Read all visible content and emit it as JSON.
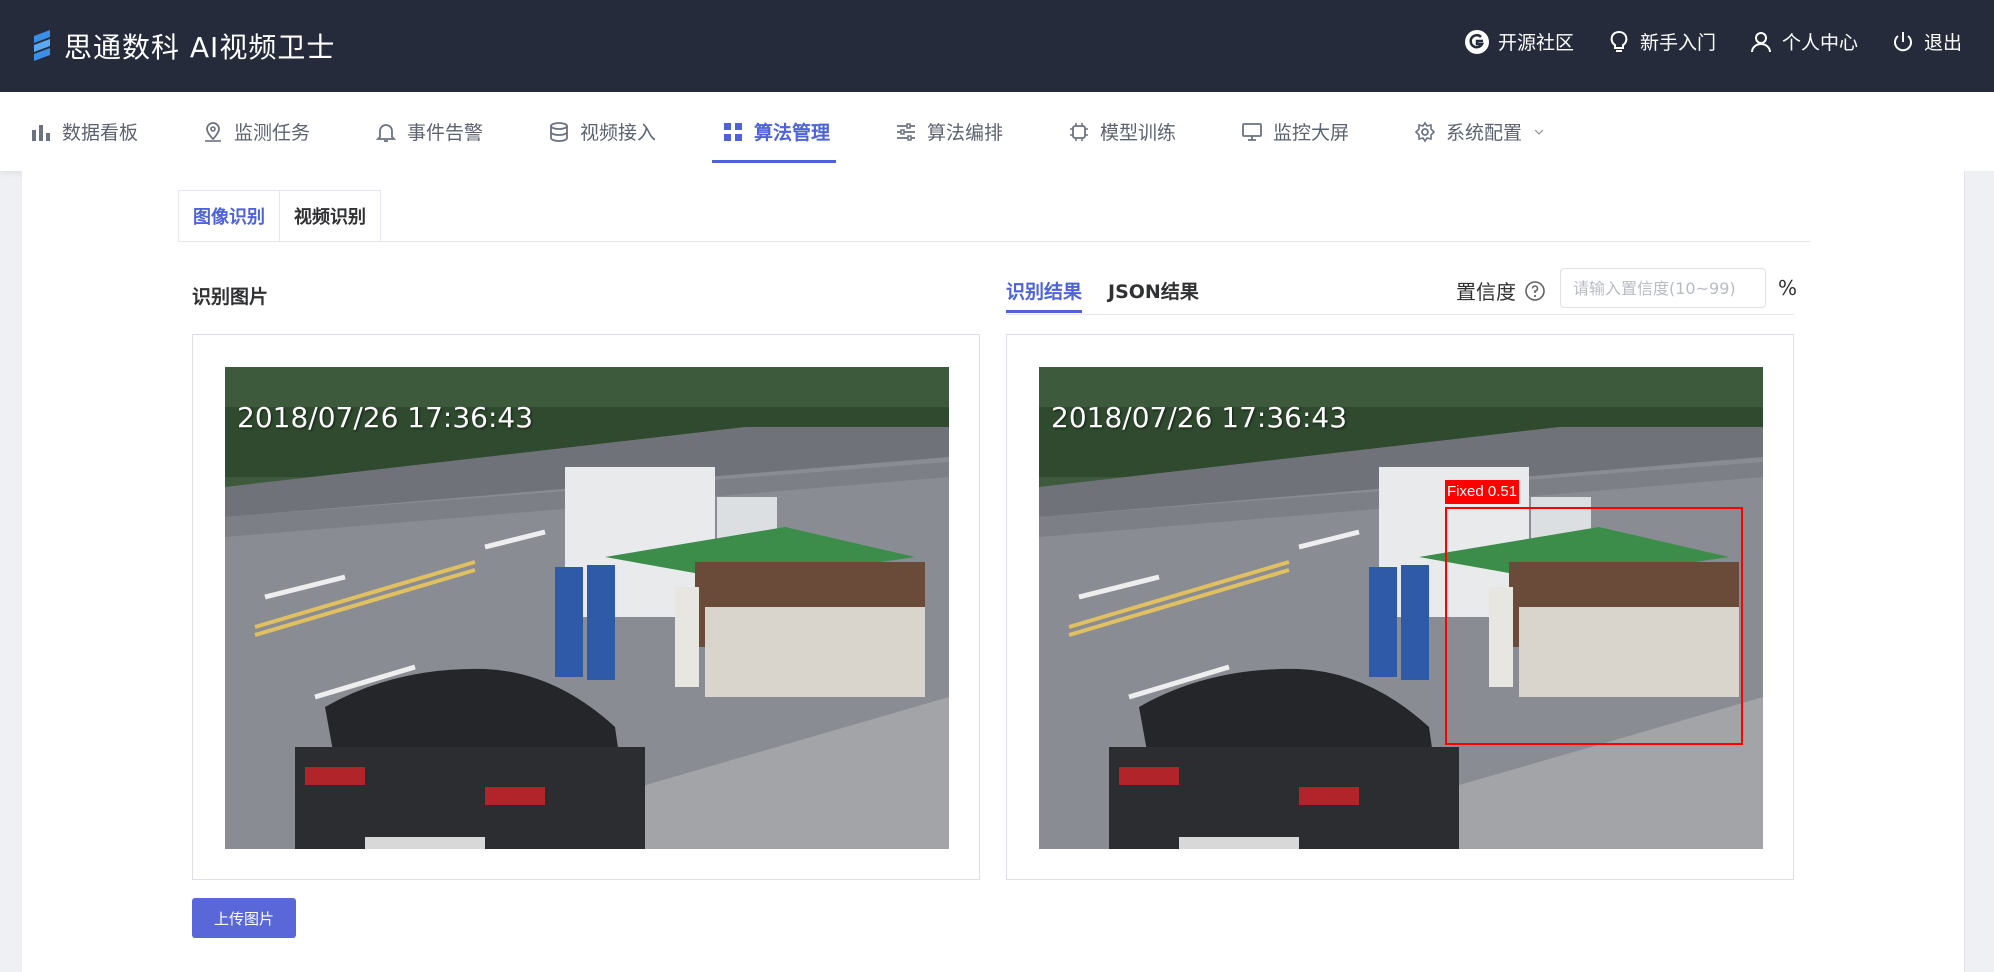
{
  "app": {
    "title": "思通数科 AI视频卫士"
  },
  "top_links": [
    {
      "label": "开源社区",
      "icon": "open-source-icon"
    },
    {
      "label": "新手入门",
      "icon": "lightbulb-icon"
    },
    {
      "label": "个人中心",
      "icon": "user-icon"
    },
    {
      "label": "退出",
      "icon": "power-icon"
    }
  ],
  "nav": [
    {
      "label": "数据看板",
      "icon": "bar-chart-icon"
    },
    {
      "label": "监测任务",
      "icon": "location-icon"
    },
    {
      "label": "事件告警",
      "icon": "bell-icon"
    },
    {
      "label": "视频接入",
      "icon": "database-icon"
    },
    {
      "label": "算法管理",
      "icon": "grid-icon",
      "active": true
    },
    {
      "label": "算法编排",
      "icon": "sliders-icon"
    },
    {
      "label": "模型训练",
      "icon": "chip-icon"
    },
    {
      "label": "监控大屏",
      "icon": "monitor-icon"
    },
    {
      "label": "系统配置",
      "icon": "gear-icon"
    }
  ],
  "subtabs": [
    "图像识别",
    "视频识别"
  ],
  "left_panel": {
    "title": "识别图片",
    "timestamp": "2018/07/26 17:36:43"
  },
  "result_tabs": [
    "识别结果",
    "JSON结果"
  ],
  "confidence": {
    "label": "置信度",
    "placeholder": "请输入置信度(10~99)",
    "unit": "%"
  },
  "detection": {
    "label": "Fixed 0.51",
    "color": "#ff0000"
  },
  "upload_button": "上传图片",
  "colors": {
    "accent": "#4f63d8",
    "topbar": "#252b3b"
  }
}
